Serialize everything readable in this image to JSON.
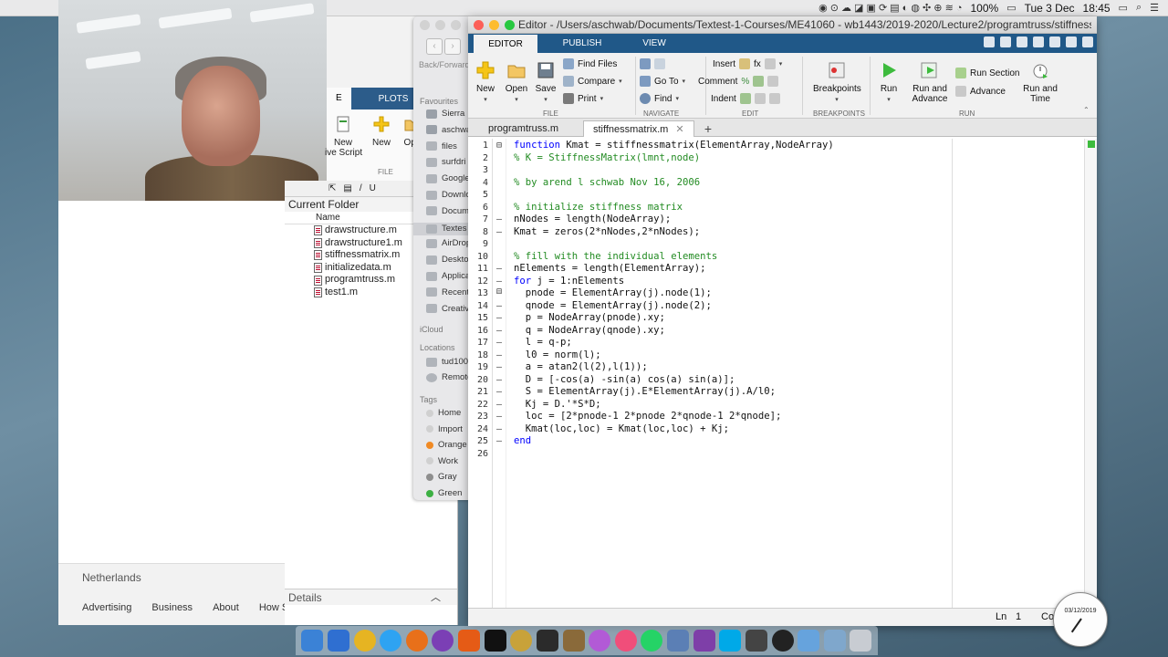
{
  "menubar": {
    "battery": "100%",
    "date": "Tue 3 Dec",
    "time": "18:45"
  },
  "browser": {
    "back_forward": "Back/Forward",
    "country": "Netherlands",
    "footer_links": [
      "Advertising",
      "Business",
      "About",
      "How Se"
    ]
  },
  "matlab_main": {
    "tabs": [
      "E",
      "PLOTS"
    ],
    "buttons": [
      "New\nive Script",
      "New",
      "Ope"
    ],
    "group_label": "FILE",
    "path_slash": "/",
    "path_u": "U"
  },
  "current_folder": {
    "title": "Current Folder",
    "header": "Name",
    "files": [
      "drawstructure.m",
      "drawstructure1.m",
      "stiffnessmatrix.m",
      "initializedata.m",
      "programtruss.m",
      "test1.m"
    ],
    "details": "Details"
  },
  "finder": {
    "favourites_label": "Favourites",
    "favourites": [
      "Sierra",
      "aschwab",
      "files",
      "surfdri",
      "Google",
      "Downlo",
      "Docum",
      "Textes",
      "AirDrop",
      "Deskto",
      "Applica",
      "Recent",
      "Creativ"
    ],
    "icloud_label": "iCloud",
    "locations_label": "Locations",
    "locations": [
      "tud100",
      "Remote"
    ],
    "tags_label": "Tags",
    "tags": [
      {
        "name": "Home",
        "color": "#d0d0d0"
      },
      {
        "name": "Import",
        "color": "#d0d0d0"
      },
      {
        "name": "Orange",
        "color": "#f08a24"
      },
      {
        "name": "Work",
        "color": "#d0d0d0"
      },
      {
        "name": "Gray",
        "color": "#8e8e8e"
      },
      {
        "name": "Green",
        "color": "#3cb043"
      }
    ]
  },
  "editor": {
    "title": "Editor - /Users/aschwab/Documents/Textest-1-Courses/ME41060 - wb1443/2019-2020/Lecture2/programtruss/stiffnessmatrix.m",
    "ribbon_tabs": [
      "EDITOR",
      "PUBLISH",
      "VIEW"
    ],
    "ribbon": {
      "new": "New",
      "open": "Open",
      "save": "Save",
      "find_files": "Find Files",
      "compare": "Compare",
      "print": "Print",
      "go_to": "Go To",
      "find": "Find",
      "insert": "Insert",
      "comment": "Comment",
      "indent": "Indent",
      "breakpoints": "Breakpoints",
      "run": "Run",
      "run_and_advance": "Run and\nAdvance",
      "run_section": "Run Section",
      "advance": "Advance",
      "run_and_time": "Run and\nTime",
      "groups": [
        "FILE",
        "NAVIGATE",
        "EDIT",
        "BREAKPOINTS",
        "RUN"
      ]
    },
    "file_tabs": [
      "programtruss.m",
      "stiffnessmatrix.m"
    ],
    "close_glyph": "✕",
    "plus": "+",
    "code_lines": [
      {
        "n": "1",
        "m": "⊟",
        "t": "function Kmat = stiffnessmatrix(ElementArray,NodeArray)",
        "k": "fn"
      },
      {
        "n": "2",
        "m": "",
        "t": "% K = StiffnessMatrix(lmnt,node)",
        "k": "cm"
      },
      {
        "n": "3",
        "m": "",
        "t": "",
        "k": ""
      },
      {
        "n": "4",
        "m": "",
        "t": "% by arend l schwab Nov 16, 2006",
        "k": "cm"
      },
      {
        "n": "5",
        "m": "",
        "t": "",
        "k": ""
      },
      {
        "n": "6",
        "m": "",
        "t": "% initialize stiffness matrix",
        "k": "cm"
      },
      {
        "n": "7",
        "m": "–",
        "t": "nNodes = length(NodeArray);",
        "k": ""
      },
      {
        "n": "8",
        "m": "–",
        "t": "Kmat = zeros(2*nNodes,2*nNodes);",
        "k": ""
      },
      {
        "n": "9",
        "m": "",
        "t": "",
        "k": ""
      },
      {
        "n": "10",
        "m": "",
        "t": "% fill with the individual elements",
        "k": "cm"
      },
      {
        "n": "11",
        "m": "–",
        "t": "nElements = length(ElementArray);",
        "k": ""
      },
      {
        "n": "12",
        "m": "–  ⊟",
        "t": "for j = 1:nElements",
        "k": "fn"
      },
      {
        "n": "13",
        "m": "–",
        "t": "  pnode = ElementArray(j).node(1);",
        "k": ""
      },
      {
        "n": "14",
        "m": "–",
        "t": "  qnode = ElementArray(j).node(2);",
        "k": ""
      },
      {
        "n": "15",
        "m": "–",
        "t": "  p = NodeArray(pnode).xy;",
        "k": ""
      },
      {
        "n": "16",
        "m": "–",
        "t": "  q = NodeArray(qnode).xy;",
        "k": ""
      },
      {
        "n": "17",
        "m": "–",
        "t": "  l = q-p;",
        "k": ""
      },
      {
        "n": "18",
        "m": "–",
        "t": "  l0 = norm(l);",
        "k": ""
      },
      {
        "n": "19",
        "m": "–",
        "t": "  a = atan2(l(2),l(1));",
        "k": ""
      },
      {
        "n": "20",
        "m": "–",
        "t": "  D = [-cos(a) -sin(a) cos(a) sin(a)];",
        "k": ""
      },
      {
        "n": "21",
        "m": "–",
        "t": "  S = ElementArray(j).E*ElementArray(j).A/l0;",
        "k": ""
      },
      {
        "n": "22",
        "m": "–",
        "t": "  Kj = D.'*S*D;",
        "k": ""
      },
      {
        "n": "23",
        "m": "–",
        "t": "  loc = [2*pnode-1 2*pnode 2*qnode-1 2*qnode];",
        "k": ""
      },
      {
        "n": "24",
        "m": "–",
        "t": "  Kmat(loc,loc) = Kmat(loc,loc) + Kj;",
        "k": ""
      },
      {
        "n": "25",
        "m": "–",
        "t": "end",
        "k": "kw"
      },
      {
        "n": "26",
        "m": "",
        "t": "",
        "k": ""
      }
    ],
    "status_ln": "Ln",
    "status_ln_val": "1",
    "status_col": "Co"
  },
  "clock": {
    "date": "03/12/2019"
  }
}
